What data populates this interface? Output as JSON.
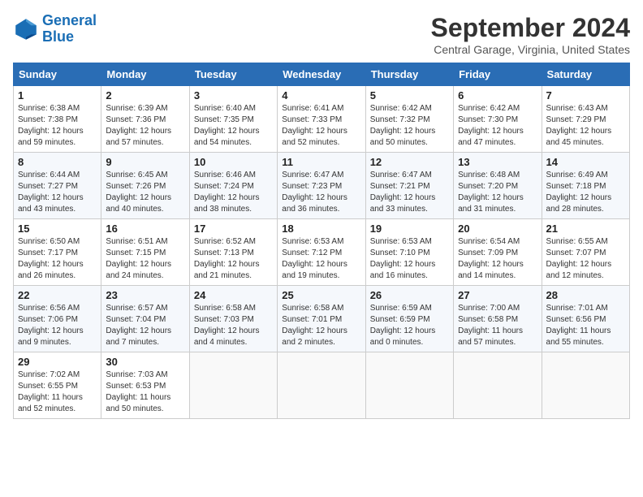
{
  "header": {
    "logo_line1": "General",
    "logo_line2": "Blue",
    "month_title": "September 2024",
    "subtitle": "Central Garage, Virginia, United States"
  },
  "weekdays": [
    "Sunday",
    "Monday",
    "Tuesday",
    "Wednesday",
    "Thursday",
    "Friday",
    "Saturday"
  ],
  "weeks": [
    [
      {
        "day": "1",
        "info": "Sunrise: 6:38 AM\nSunset: 7:38 PM\nDaylight: 12 hours\nand 59 minutes."
      },
      {
        "day": "2",
        "info": "Sunrise: 6:39 AM\nSunset: 7:36 PM\nDaylight: 12 hours\nand 57 minutes."
      },
      {
        "day": "3",
        "info": "Sunrise: 6:40 AM\nSunset: 7:35 PM\nDaylight: 12 hours\nand 54 minutes."
      },
      {
        "day": "4",
        "info": "Sunrise: 6:41 AM\nSunset: 7:33 PM\nDaylight: 12 hours\nand 52 minutes."
      },
      {
        "day": "5",
        "info": "Sunrise: 6:42 AM\nSunset: 7:32 PM\nDaylight: 12 hours\nand 50 minutes."
      },
      {
        "day": "6",
        "info": "Sunrise: 6:42 AM\nSunset: 7:30 PM\nDaylight: 12 hours\nand 47 minutes."
      },
      {
        "day": "7",
        "info": "Sunrise: 6:43 AM\nSunset: 7:29 PM\nDaylight: 12 hours\nand 45 minutes."
      }
    ],
    [
      {
        "day": "8",
        "info": "Sunrise: 6:44 AM\nSunset: 7:27 PM\nDaylight: 12 hours\nand 43 minutes."
      },
      {
        "day": "9",
        "info": "Sunrise: 6:45 AM\nSunset: 7:26 PM\nDaylight: 12 hours\nand 40 minutes."
      },
      {
        "day": "10",
        "info": "Sunrise: 6:46 AM\nSunset: 7:24 PM\nDaylight: 12 hours\nand 38 minutes."
      },
      {
        "day": "11",
        "info": "Sunrise: 6:47 AM\nSunset: 7:23 PM\nDaylight: 12 hours\nand 36 minutes."
      },
      {
        "day": "12",
        "info": "Sunrise: 6:47 AM\nSunset: 7:21 PM\nDaylight: 12 hours\nand 33 minutes."
      },
      {
        "day": "13",
        "info": "Sunrise: 6:48 AM\nSunset: 7:20 PM\nDaylight: 12 hours\nand 31 minutes."
      },
      {
        "day": "14",
        "info": "Sunrise: 6:49 AM\nSunset: 7:18 PM\nDaylight: 12 hours\nand 28 minutes."
      }
    ],
    [
      {
        "day": "15",
        "info": "Sunrise: 6:50 AM\nSunset: 7:17 PM\nDaylight: 12 hours\nand 26 minutes."
      },
      {
        "day": "16",
        "info": "Sunrise: 6:51 AM\nSunset: 7:15 PM\nDaylight: 12 hours\nand 24 minutes."
      },
      {
        "day": "17",
        "info": "Sunrise: 6:52 AM\nSunset: 7:13 PM\nDaylight: 12 hours\nand 21 minutes."
      },
      {
        "day": "18",
        "info": "Sunrise: 6:53 AM\nSunset: 7:12 PM\nDaylight: 12 hours\nand 19 minutes."
      },
      {
        "day": "19",
        "info": "Sunrise: 6:53 AM\nSunset: 7:10 PM\nDaylight: 12 hours\nand 16 minutes."
      },
      {
        "day": "20",
        "info": "Sunrise: 6:54 AM\nSunset: 7:09 PM\nDaylight: 12 hours\nand 14 minutes."
      },
      {
        "day": "21",
        "info": "Sunrise: 6:55 AM\nSunset: 7:07 PM\nDaylight: 12 hours\nand 12 minutes."
      }
    ],
    [
      {
        "day": "22",
        "info": "Sunrise: 6:56 AM\nSunset: 7:06 PM\nDaylight: 12 hours\nand 9 minutes."
      },
      {
        "day": "23",
        "info": "Sunrise: 6:57 AM\nSunset: 7:04 PM\nDaylight: 12 hours\nand 7 minutes."
      },
      {
        "day": "24",
        "info": "Sunrise: 6:58 AM\nSunset: 7:03 PM\nDaylight: 12 hours\nand 4 minutes."
      },
      {
        "day": "25",
        "info": "Sunrise: 6:58 AM\nSunset: 7:01 PM\nDaylight: 12 hours\nand 2 minutes."
      },
      {
        "day": "26",
        "info": "Sunrise: 6:59 AM\nSunset: 6:59 PM\nDaylight: 12 hours\nand 0 minutes."
      },
      {
        "day": "27",
        "info": "Sunrise: 7:00 AM\nSunset: 6:58 PM\nDaylight: 11 hours\nand 57 minutes."
      },
      {
        "day": "28",
        "info": "Sunrise: 7:01 AM\nSunset: 6:56 PM\nDaylight: 11 hours\nand 55 minutes."
      }
    ],
    [
      {
        "day": "29",
        "info": "Sunrise: 7:02 AM\nSunset: 6:55 PM\nDaylight: 11 hours\nand 52 minutes."
      },
      {
        "day": "30",
        "info": "Sunrise: 7:03 AM\nSunset: 6:53 PM\nDaylight: 11 hours\nand 50 minutes."
      },
      {
        "day": "",
        "info": ""
      },
      {
        "day": "",
        "info": ""
      },
      {
        "day": "",
        "info": ""
      },
      {
        "day": "",
        "info": ""
      },
      {
        "day": "",
        "info": ""
      }
    ]
  ]
}
